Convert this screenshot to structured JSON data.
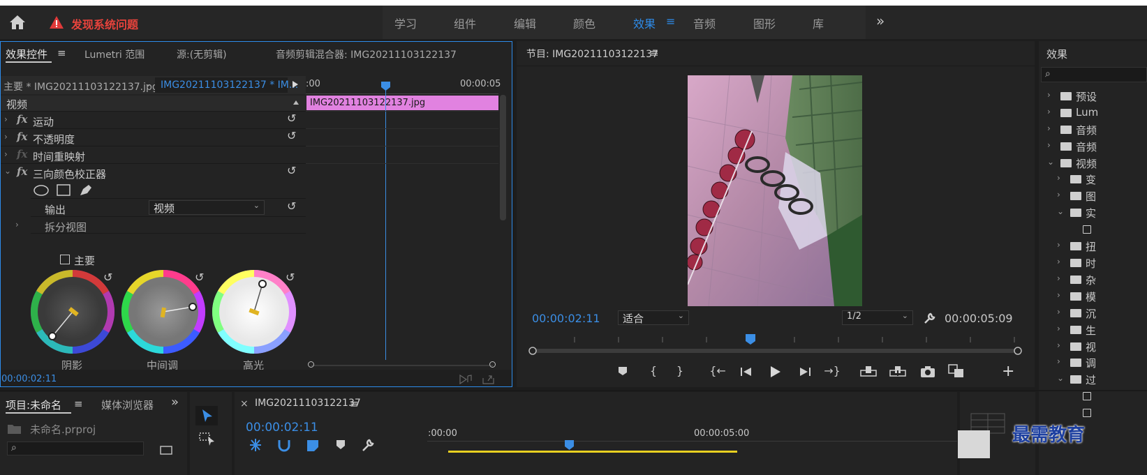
{
  "workspace_bar": {
    "alert_text": "发现系统问题",
    "tabs": [
      "学习",
      "组件",
      "编辑",
      "颜色",
      "效果",
      "音频",
      "图形",
      "库"
    ],
    "active_tab": "效果",
    "more": "»"
  },
  "effect_controls": {
    "tabs": [
      "效果控件",
      "Lumetri 范围",
      "源:(无剪辑)",
      "音频剪辑混合器: IMG20211103122137"
    ],
    "menu_glyph": "≡",
    "master_clip": "主要 * IMG20211103122137.jpg",
    "sequence_clip": "IMG20211103122137 * IM...",
    "ruler_start": ":00",
    "ruler_end": "00:00:05",
    "clip_name": "IMG20211103122137.jpg",
    "section_video": "视频",
    "effects": [
      {
        "label": "运动",
        "has_reset": true,
        "dim": false
      },
      {
        "label": "不透明度",
        "has_reset": true,
        "dim": false
      },
      {
        "label": "时间重映射",
        "has_reset": false,
        "dim": true
      },
      {
        "label": "三向颜色校正器",
        "has_reset": true,
        "dim": false
      }
    ],
    "output_label": "输出",
    "output_value": "视频",
    "split_view_label": "拆分视图",
    "master_checkbox_label": "主要",
    "wheels": [
      "阴影",
      "中间调",
      "高光"
    ],
    "timecode": "00:00:02:11"
  },
  "program_monitor": {
    "title": "节目: IMG20211103122137",
    "timecode": "00:00:02:11",
    "fit_value": "适合",
    "resolution_value": "1/2",
    "duration": "00:00:05:09"
  },
  "effects_panel": {
    "title": "效果",
    "items": [
      "预设",
      "Lum",
      "音频",
      "音频",
      "视频",
      "变",
      "图",
      "实",
      "",
      "扭",
      "时",
      "杂",
      "模",
      "沉",
      "生",
      "视",
      "调",
      "过",
      "",
      ""
    ]
  },
  "project_panel": {
    "tabs": [
      "项目:未命名",
      "媒体浏览器"
    ],
    "file": "未命名.prproj"
  },
  "timeline": {
    "title": "IMG20211103122137",
    "close_glyph": "×",
    "timecode": "00:00:02:11",
    "ruler_start": ":00:00",
    "ruler_mid": "00:00:05:00"
  },
  "watermark": "最需教育"
}
